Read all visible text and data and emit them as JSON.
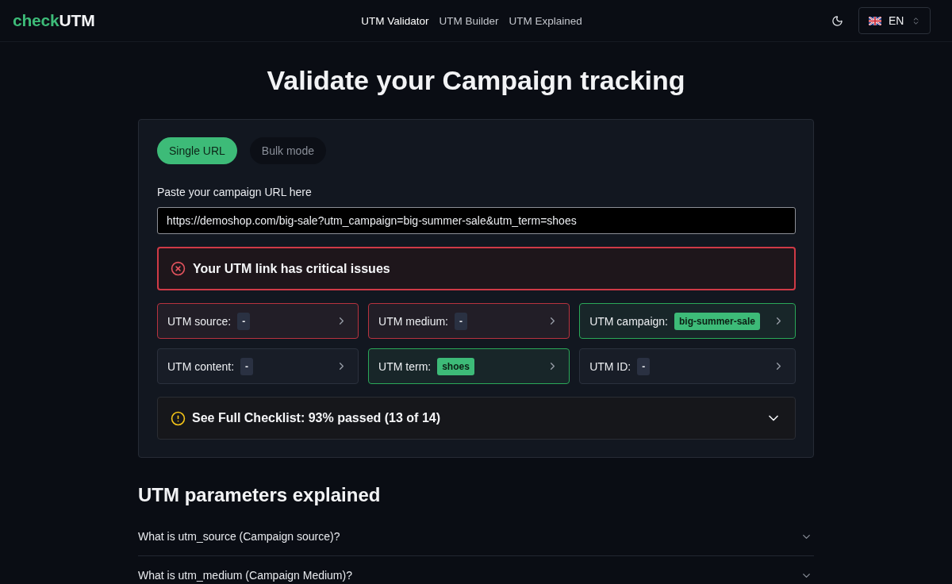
{
  "header": {
    "logo": {
      "prefix": "check",
      "suffix": "UTM"
    },
    "nav": [
      {
        "label": "UTM Validator",
        "selected": true
      },
      {
        "label": "UTM Builder",
        "selected": false
      },
      {
        "label": "UTM Explained",
        "selected": false
      }
    ],
    "language": {
      "code": "EN"
    }
  },
  "title": "Validate your Campaign tracking",
  "validator": {
    "tabs": [
      {
        "label": "Single URL",
        "selected": true
      },
      {
        "label": "Bulk mode",
        "selected": false
      }
    ],
    "url_field": {
      "label": "Paste your campaign URL here",
      "value": "https://demoshop.com/big-sale?utm_campaign=big-summer-sale&utm_term=shoes"
    },
    "alert": {
      "kind": "error",
      "message": "Your UTM link has critical issues"
    },
    "parameters": [
      {
        "label": "UTM source:",
        "value": "-",
        "valid": false,
        "color": "#b8333f"
      },
      {
        "label": "UTM medium:",
        "value": "-",
        "valid": false,
        "color": "#b8333f"
      },
      {
        "label": "UTM campaign:",
        "value": "big-summer-sale",
        "valid": true,
        "color": "#2aa858"
      },
      {
        "label": "UTM content:",
        "value": "-",
        "valid": false,
        "color": "#2b313d"
      },
      {
        "label": "UTM term:",
        "value": "shoes",
        "valid": true,
        "color": "#2aa858"
      },
      {
        "label": "UTM ID:",
        "value": "-",
        "valid": false,
        "color": "#2b313d"
      }
    ],
    "checklist": {
      "summary": "See Full Checklist: 93% passed (13 of 14)",
      "expanded": false
    }
  },
  "faq": {
    "heading": "UTM parameters explained",
    "items": [
      {
        "question": "What is utm_source (Campaign source)?",
        "expanded": false
      },
      {
        "question": "What is utm_medium (Campaign Medium)?",
        "expanded": false
      }
    ]
  }
}
